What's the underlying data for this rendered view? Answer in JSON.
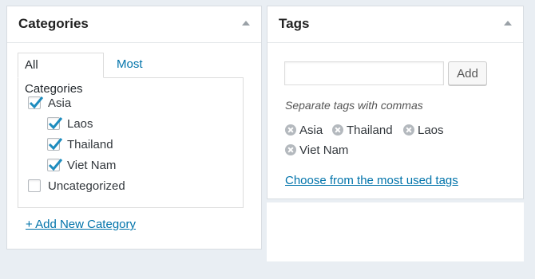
{
  "categories_box": {
    "title": "Categories",
    "tabs": [
      {
        "label": "All Categories"
      },
      {
        "label": "Most Used"
      }
    ],
    "items": [
      {
        "label": "Asia",
        "checked": true
      },
      {
        "label": "Laos",
        "checked": true
      },
      {
        "label": "Thailand",
        "checked": true
      },
      {
        "label": "Viet Nam",
        "checked": true
      },
      {
        "label": "Uncategorized",
        "checked": false
      }
    ],
    "add_new_label": "+ Add New Category"
  },
  "tags_box": {
    "title": "Tags",
    "input_value": "",
    "add_button_label": "Add",
    "hint": "Separate tags with commas",
    "tags": [
      {
        "label": "Asia"
      },
      {
        "label": "Thailand"
      },
      {
        "label": "Laos"
      },
      {
        "label": "Viet Nam"
      }
    ],
    "most_used_link": "Choose from the most used tags"
  },
  "colors": {
    "link": "#0073aa",
    "checkbox_check": "#1e8cbe",
    "background": "#e9eef3"
  }
}
